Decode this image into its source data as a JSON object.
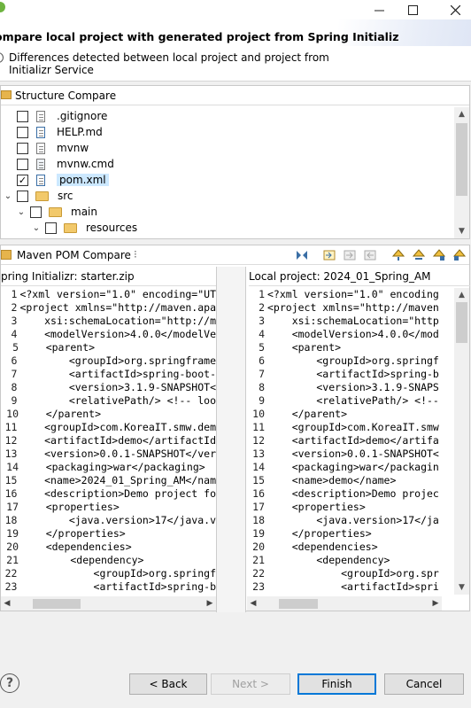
{
  "header": {
    "title": "ompare local project with generated project from Spring Initializ",
    "message": "Differences detected between local project and project from Initializr Service"
  },
  "structure_compare": {
    "title": "Structure Compare",
    "items": [
      {
        "label": ".gitignore",
        "checked": false
      },
      {
        "label": "HELP.md",
        "checked": false
      },
      {
        "label": "mvnw",
        "checked": false
      },
      {
        "label": "mvnw.cmd",
        "checked": false
      },
      {
        "label": "pom.xml",
        "checked": true
      },
      {
        "label": "src",
        "checked": false
      },
      {
        "label": "main",
        "checked": false
      },
      {
        "label": "resources",
        "checked": false
      }
    ]
  },
  "maven_compare": {
    "title": "Maven POM Compare",
    "left_title": "pring Initializr: starter.zip",
    "right_title": "Local project: 2024_01_Spring_AM",
    "left_lines": [
      "<?xml version=\"1.0\" encoding=\"UT",
      "<project xmlns=\"http://maven.apa",
      "    xsi:schemaLocation=\"http://m",
      "    <modelVersion>4.0.0</modelVe",
      "    <parent>",
      "        <groupId>org.springframe",
      "        <artifactId>spring-boot-",
      "        <version>3.1.9-SNAPSHOT<",
      "        <relativePath/> <!-- loo",
      "    </parent>",
      "    <groupId>com.KoreaIT.smw.dem",
      "    <artifactId>demo</artifactId",
      "    <version>0.0.1-SNAPSHOT</ver",
      "    <packaging>war</packaging>",
      "    <name>2024_01_Spring_AM</nam",
      "    <description>Demo project fo",
      "    <properties>",
      "        <java.version>17</java.v",
      "    </properties>",
      "    <dependencies>",
      "        <dependency>",
      "            <groupId>org.springf",
      "            <artifactId>spring-b"
    ],
    "right_lines": [
      "<?xml version=\"1.0\" encoding",
      "<project xmlns=\"http://maven",
      "    xsi:schemaLocation=\"http",
      "    <modelVersion>4.0.0</mod",
      "    <parent>",
      "        <groupId>org.springf",
      "        <artifactId>spring-b",
      "        <version>3.1.9-SNAPS",
      "        <relativePath/> <!--",
      "    </parent>",
      "    <groupId>com.KoreaIT.smw",
      "    <artifactId>demo</artifa",
      "    <version>0.0.1-SNAPSHOT<",
      "    <packaging>war</packagin",
      "    <name>demo</name>",
      "    <description>Demo projec",
      "    <properties>",
      "        <java.version>17</ja",
      "    </properties>",
      "    <dependencies>",
      "        <dependency>",
      "            <groupId>org.spr",
      "            <artifactId>spri"
    ]
  },
  "footer": {
    "help": "?",
    "back": "< Back",
    "next": "Next >",
    "finish": "Finish",
    "cancel": "Cancel"
  }
}
